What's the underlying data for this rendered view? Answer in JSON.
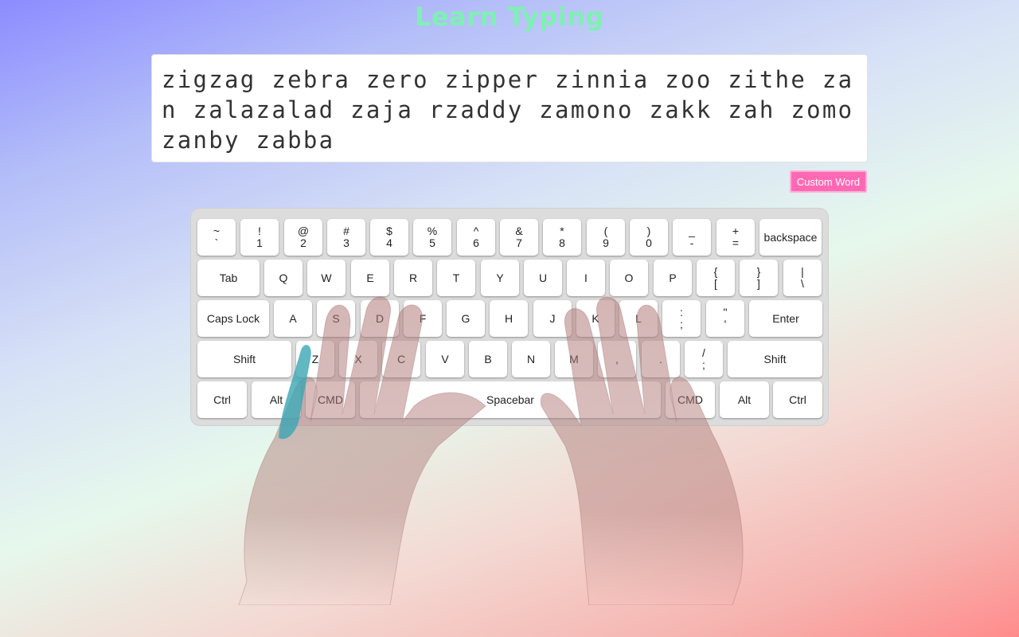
{
  "title": "Learn Typing",
  "practice_text": "zigzag zebra zero zipper zinnia zoo zithe zan zalazalad zaja rzaddy zamono zakk zah zomo zanby zabba",
  "custom_word_button": "Custom Word",
  "keyboard": {
    "row1": [
      {
        "top": "~",
        "bottom": "`"
      },
      {
        "top": "!",
        "bottom": "1"
      },
      {
        "top": "@",
        "bottom": "2"
      },
      {
        "top": "#",
        "bottom": "3"
      },
      {
        "top": "$",
        "bottom": "4"
      },
      {
        "top": "%",
        "bottom": "5"
      },
      {
        "top": "^",
        "bottom": "6"
      },
      {
        "top": "&",
        "bottom": "7"
      },
      {
        "top": "*",
        "bottom": "8"
      },
      {
        "top": "(",
        "bottom": "9"
      },
      {
        "top": ")",
        "bottom": "0"
      },
      {
        "top": "_",
        "bottom": "-"
      },
      {
        "top": "+",
        "bottom": "="
      },
      {
        "label": "backspace"
      }
    ],
    "row2": [
      {
        "label": "Tab"
      },
      {
        "label": "Q"
      },
      {
        "label": "W"
      },
      {
        "label": "E"
      },
      {
        "label": "R"
      },
      {
        "label": "T"
      },
      {
        "label": "Y"
      },
      {
        "label": "U"
      },
      {
        "label": "I"
      },
      {
        "label": "O"
      },
      {
        "label": "P"
      },
      {
        "top": "{",
        "bottom": "["
      },
      {
        "top": "}",
        "bottom": "]"
      },
      {
        "top": "|",
        "bottom": "\\"
      }
    ],
    "row3": [
      {
        "label": "Caps Lock"
      },
      {
        "label": "A"
      },
      {
        "label": "S"
      },
      {
        "label": "D"
      },
      {
        "label": "F"
      },
      {
        "label": "G"
      },
      {
        "label": "H"
      },
      {
        "label": "J"
      },
      {
        "label": "K"
      },
      {
        "label": "L"
      },
      {
        "top": ":",
        "bottom": ";"
      },
      {
        "top": "\"",
        "bottom": "'"
      },
      {
        "label": "Enter"
      }
    ],
    "row4": [
      {
        "label": "Shift"
      },
      {
        "label": "Z"
      },
      {
        "label": "X"
      },
      {
        "label": "C"
      },
      {
        "label": "V"
      },
      {
        "label": "B"
      },
      {
        "label": "N"
      },
      {
        "label": "M"
      },
      {
        "label": ","
      },
      {
        "label": "."
      },
      {
        "top": "/",
        "bottom": ";"
      },
      {
        "label": "Shift"
      }
    ],
    "row5": [
      {
        "label": "Ctrl"
      },
      {
        "label": "Alt"
      },
      {
        "label": "CMD"
      },
      {
        "label": "Spacebar"
      },
      {
        "label": "CMD"
      },
      {
        "label": "Alt"
      },
      {
        "label": "Ctrl"
      }
    ]
  },
  "highlight_finger": "left-pinky",
  "colors": {
    "title": "#7ff0b4",
    "custom_button": "#ff69b4",
    "finger_highlight": "#3aa6b4",
    "hands": "#b47a78"
  }
}
